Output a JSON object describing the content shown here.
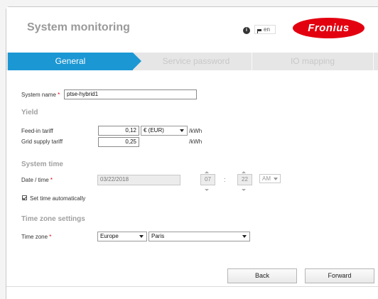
{
  "header": {
    "title": "System monitoring",
    "info_icon": "i",
    "language": "en",
    "logo_text": "Fronius"
  },
  "tabs": [
    {
      "label": "General",
      "active": true
    },
    {
      "label": "Service password",
      "active": false
    },
    {
      "label": "IO mapping",
      "active": false
    }
  ],
  "system_name": {
    "label": "System name",
    "required": "*",
    "value": "ptse-hybrid1"
  },
  "yield": {
    "heading": "Yield",
    "feed_in": {
      "label": "Feed-in tariff",
      "value": "0,12",
      "currency": "€ (EUR)",
      "unit": "/kWh"
    },
    "grid_supply": {
      "label": "Grid supply tariff",
      "value": "0,25",
      "unit": "/kWh"
    }
  },
  "system_time": {
    "heading": "System time",
    "date_label": "Date / time",
    "required": "*",
    "date_value": "03/22/2018",
    "hour": "07",
    "separator": ":",
    "minute": "22",
    "ampm": "AM",
    "auto_label": "Set time automatically"
  },
  "timezone": {
    "heading": "Time zone settings",
    "label": "Time zone",
    "required": "*",
    "region": "Europe",
    "city": "Paris"
  },
  "buttons": {
    "back": "Back",
    "forward": "Forward"
  },
  "colors": {
    "accent": "#1b97d4",
    "brand": "#e3000f"
  }
}
